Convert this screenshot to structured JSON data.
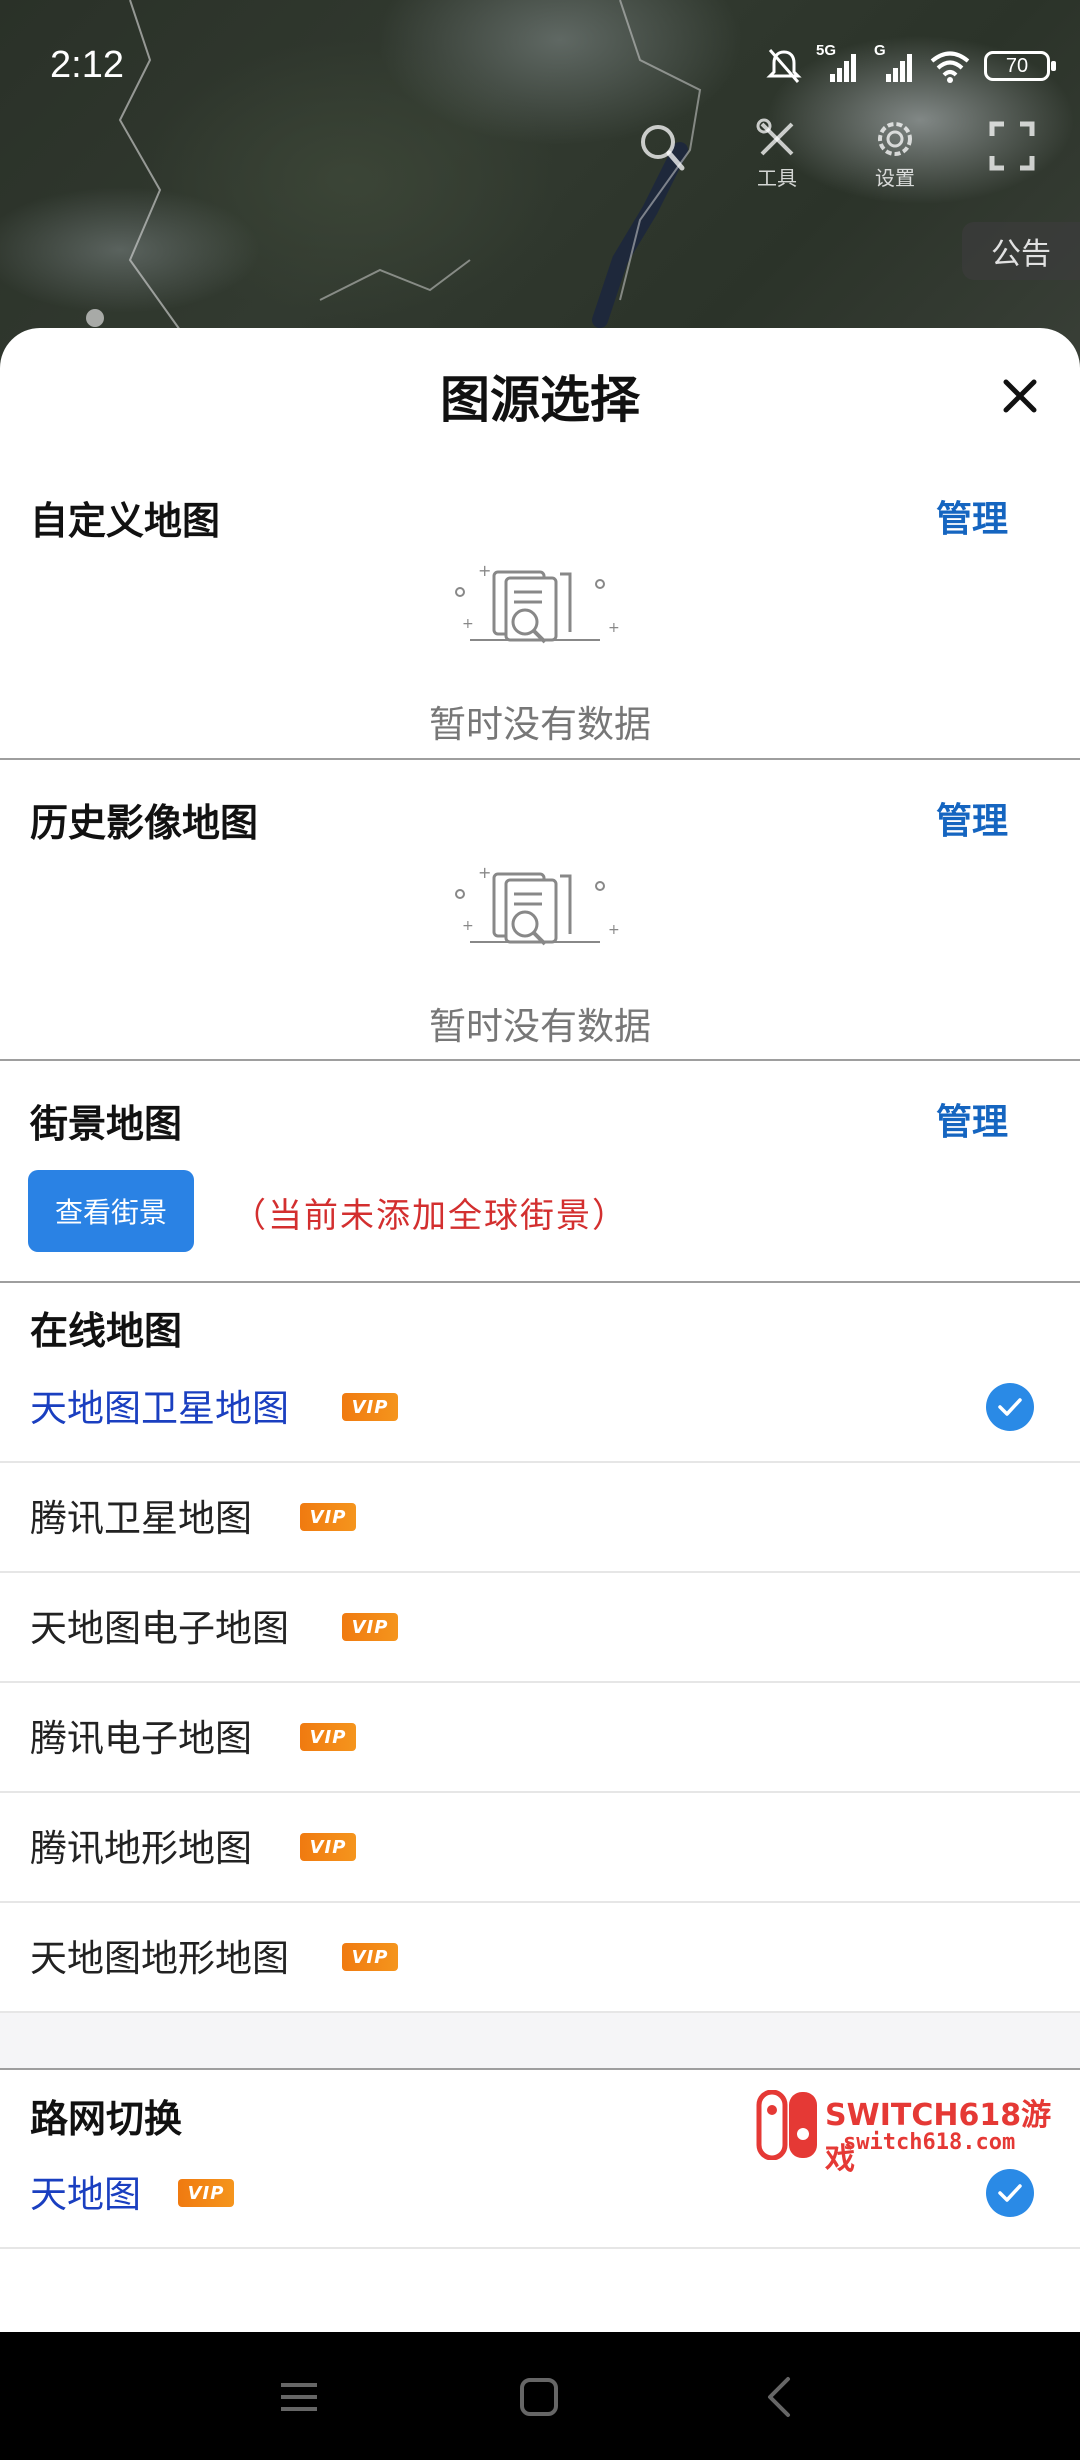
{
  "status_bar": {
    "time": "2:12",
    "network_label": "5G",
    "network_label_2": "G",
    "battery": "70"
  },
  "map_toolbar": {
    "tools_label": "工具",
    "settings_label": "设置",
    "notice_label": "公告"
  },
  "sheet": {
    "title": "图源选择",
    "custom_maps": {
      "title": "自定义地图",
      "manage_label": "管理",
      "empty_text": "暂时没有数据"
    },
    "history_maps": {
      "title": "历史影像地图",
      "manage_label": "管理",
      "empty_text": "暂时没有数据"
    },
    "street_view": {
      "title": "街景地图",
      "manage_label": "管理",
      "button_label": "查看街景",
      "note": "（当前未添加全球街景）"
    },
    "online_maps": {
      "title": "在线地图",
      "items": [
        {
          "name": "天地图卫星地图",
          "vip": "VIP",
          "selected": true
        },
        {
          "name": "腾讯卫星地图",
          "vip": "VIP",
          "selected": false
        },
        {
          "name": "天地图电子地图",
          "vip": "VIP",
          "selected": false
        },
        {
          "name": "腾讯电子地图",
          "vip": "VIP",
          "selected": false
        },
        {
          "name": "腾讯地形地图",
          "vip": "VIP",
          "selected": false
        },
        {
          "name": "天地图地形地图",
          "vip": "VIP",
          "selected": false
        }
      ]
    },
    "road_network": {
      "title": "路网切换",
      "items": [
        {
          "name": "天地图",
          "vip": "VIP",
          "selected": true
        }
      ]
    }
  },
  "watermark": {
    "line1": "SWITCH618游戏",
    "line2": "switch618.com"
  },
  "colors": {
    "accent_blue": "#2a82e4",
    "manage_link": "#1565c0",
    "selected_text": "#1a3fc0",
    "note_red": "#d32f2f",
    "vip_orange": "#f07a10"
  }
}
